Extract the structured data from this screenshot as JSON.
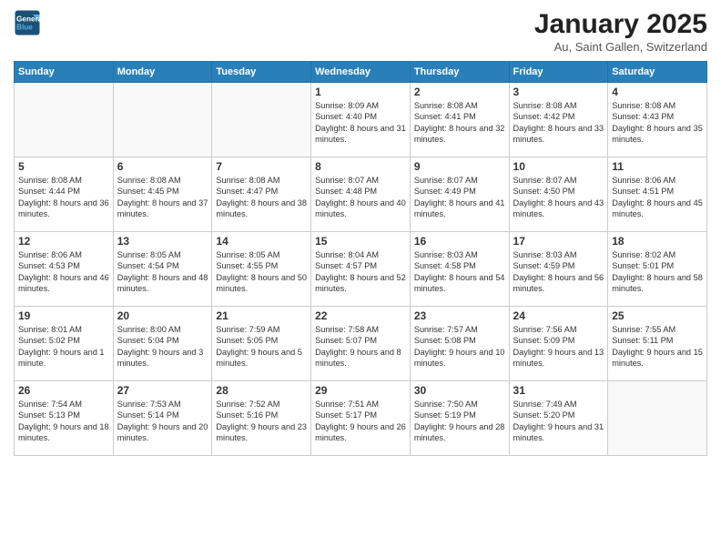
{
  "header": {
    "logo_line1": "General",
    "logo_line2": "Blue",
    "title": "January 2025",
    "subtitle": "Au, Saint Gallen, Switzerland"
  },
  "days_of_week": [
    "Sunday",
    "Monday",
    "Tuesday",
    "Wednesday",
    "Thursday",
    "Friday",
    "Saturday"
  ],
  "weeks": [
    [
      {
        "day": "",
        "info": ""
      },
      {
        "day": "",
        "info": ""
      },
      {
        "day": "",
        "info": ""
      },
      {
        "day": "1",
        "info": "Sunrise: 8:09 AM\nSunset: 4:40 PM\nDaylight: 8 hours and 31 minutes."
      },
      {
        "day": "2",
        "info": "Sunrise: 8:08 AM\nSunset: 4:41 PM\nDaylight: 8 hours and 32 minutes."
      },
      {
        "day": "3",
        "info": "Sunrise: 8:08 AM\nSunset: 4:42 PM\nDaylight: 8 hours and 33 minutes."
      },
      {
        "day": "4",
        "info": "Sunrise: 8:08 AM\nSunset: 4:43 PM\nDaylight: 8 hours and 35 minutes."
      }
    ],
    [
      {
        "day": "5",
        "info": "Sunrise: 8:08 AM\nSunset: 4:44 PM\nDaylight: 8 hours and 36 minutes."
      },
      {
        "day": "6",
        "info": "Sunrise: 8:08 AM\nSunset: 4:45 PM\nDaylight: 8 hours and 37 minutes."
      },
      {
        "day": "7",
        "info": "Sunrise: 8:08 AM\nSunset: 4:47 PM\nDaylight: 8 hours and 38 minutes."
      },
      {
        "day": "8",
        "info": "Sunrise: 8:07 AM\nSunset: 4:48 PM\nDaylight: 8 hours and 40 minutes."
      },
      {
        "day": "9",
        "info": "Sunrise: 8:07 AM\nSunset: 4:49 PM\nDaylight: 8 hours and 41 minutes."
      },
      {
        "day": "10",
        "info": "Sunrise: 8:07 AM\nSunset: 4:50 PM\nDaylight: 8 hours and 43 minutes."
      },
      {
        "day": "11",
        "info": "Sunrise: 8:06 AM\nSunset: 4:51 PM\nDaylight: 8 hours and 45 minutes."
      }
    ],
    [
      {
        "day": "12",
        "info": "Sunrise: 8:06 AM\nSunset: 4:53 PM\nDaylight: 8 hours and 46 minutes."
      },
      {
        "day": "13",
        "info": "Sunrise: 8:05 AM\nSunset: 4:54 PM\nDaylight: 8 hours and 48 minutes."
      },
      {
        "day": "14",
        "info": "Sunrise: 8:05 AM\nSunset: 4:55 PM\nDaylight: 8 hours and 50 minutes."
      },
      {
        "day": "15",
        "info": "Sunrise: 8:04 AM\nSunset: 4:57 PM\nDaylight: 8 hours and 52 minutes."
      },
      {
        "day": "16",
        "info": "Sunrise: 8:03 AM\nSunset: 4:58 PM\nDaylight: 8 hours and 54 minutes."
      },
      {
        "day": "17",
        "info": "Sunrise: 8:03 AM\nSunset: 4:59 PM\nDaylight: 8 hours and 56 minutes."
      },
      {
        "day": "18",
        "info": "Sunrise: 8:02 AM\nSunset: 5:01 PM\nDaylight: 8 hours and 58 minutes."
      }
    ],
    [
      {
        "day": "19",
        "info": "Sunrise: 8:01 AM\nSunset: 5:02 PM\nDaylight: 9 hours and 1 minute."
      },
      {
        "day": "20",
        "info": "Sunrise: 8:00 AM\nSunset: 5:04 PM\nDaylight: 9 hours and 3 minutes."
      },
      {
        "day": "21",
        "info": "Sunrise: 7:59 AM\nSunset: 5:05 PM\nDaylight: 9 hours and 5 minutes."
      },
      {
        "day": "22",
        "info": "Sunrise: 7:58 AM\nSunset: 5:07 PM\nDaylight: 9 hours and 8 minutes."
      },
      {
        "day": "23",
        "info": "Sunrise: 7:57 AM\nSunset: 5:08 PM\nDaylight: 9 hours and 10 minutes."
      },
      {
        "day": "24",
        "info": "Sunrise: 7:56 AM\nSunset: 5:09 PM\nDaylight: 9 hours and 13 minutes."
      },
      {
        "day": "25",
        "info": "Sunrise: 7:55 AM\nSunset: 5:11 PM\nDaylight: 9 hours and 15 minutes."
      }
    ],
    [
      {
        "day": "26",
        "info": "Sunrise: 7:54 AM\nSunset: 5:13 PM\nDaylight: 9 hours and 18 minutes."
      },
      {
        "day": "27",
        "info": "Sunrise: 7:53 AM\nSunset: 5:14 PM\nDaylight: 9 hours and 20 minutes."
      },
      {
        "day": "28",
        "info": "Sunrise: 7:52 AM\nSunset: 5:16 PM\nDaylight: 9 hours and 23 minutes."
      },
      {
        "day": "29",
        "info": "Sunrise: 7:51 AM\nSunset: 5:17 PM\nDaylight: 9 hours and 26 minutes."
      },
      {
        "day": "30",
        "info": "Sunrise: 7:50 AM\nSunset: 5:19 PM\nDaylight: 9 hours and 28 minutes."
      },
      {
        "day": "31",
        "info": "Sunrise: 7:49 AM\nSunset: 5:20 PM\nDaylight: 9 hours and 31 minutes."
      },
      {
        "day": "",
        "info": ""
      }
    ]
  ]
}
